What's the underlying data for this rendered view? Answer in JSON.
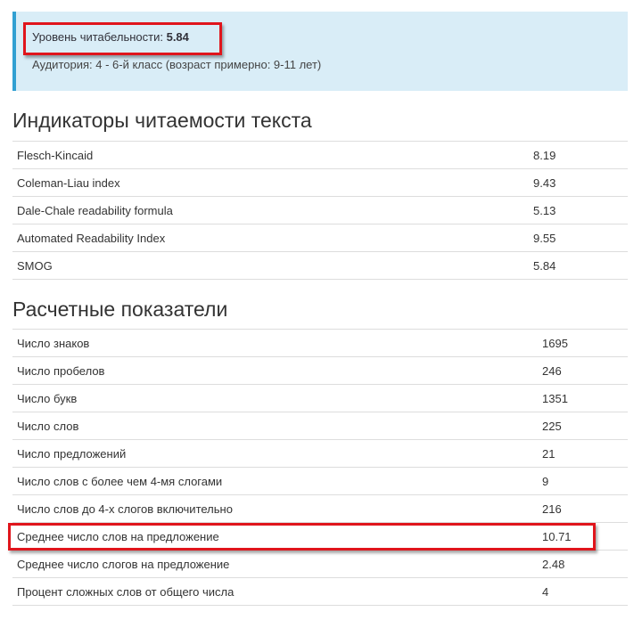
{
  "summary": {
    "level_label": "Уровень читабельности:",
    "level_value": "5.84",
    "audience": "Аудитория: 4 - 6-й класс (возраст примерно: 9-11 лет)"
  },
  "indicators": {
    "title": "Индикаторы читаемости текста",
    "rows": [
      {
        "label": "Flesch-Kincaid",
        "value": "8.19"
      },
      {
        "label": "Coleman-Liau index",
        "value": "9.43"
      },
      {
        "label": "Dale-Chale readability formula",
        "value": "5.13"
      },
      {
        "label": "Automated Readability Index",
        "value": "9.55"
      },
      {
        "label": "SMOG",
        "value": "5.84"
      }
    ]
  },
  "metrics": {
    "title": "Расчетные показатели",
    "rows": [
      {
        "label": "Число знаков",
        "value": "1695"
      },
      {
        "label": "Число пробелов",
        "value": "246"
      },
      {
        "label": "Число букв",
        "value": "1351"
      },
      {
        "label": "Число слов",
        "value": "225"
      },
      {
        "label": "Число предложений",
        "value": "21"
      },
      {
        "label": "Число слов с более чем 4-мя слогами",
        "value": "9"
      },
      {
        "label": "Число слов до 4-х слогов включительно",
        "value": "216"
      },
      {
        "label": "Среднее число слов на предложение",
        "value": "10.71"
      },
      {
        "label": "Среднее число слогов на предложение",
        "value": "2.48"
      },
      {
        "label": "Процент сложных слов от общего числа",
        "value": "4"
      }
    ]
  },
  "colors": {
    "highlight": "#e0151c",
    "panel_bg": "#d9edf7",
    "panel_border": "#31a0d2"
  }
}
